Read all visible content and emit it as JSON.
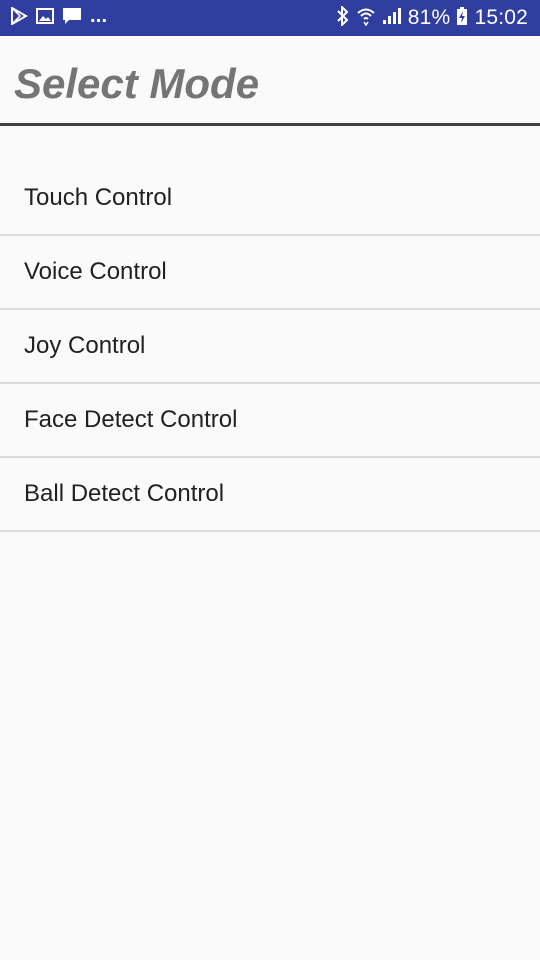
{
  "status_bar": {
    "icons_left": [
      "play-store-icon",
      "image-icon",
      "message-icon"
    ],
    "overflow": "...",
    "icons_right": [
      "bluetooth-icon",
      "wifi-icon",
      "signal-icon"
    ],
    "battery_percent": "81%",
    "time": "15:02",
    "background_color": "#303f9f"
  },
  "header": {
    "title": "Select Mode"
  },
  "modes": [
    {
      "label": "Touch Control"
    },
    {
      "label": "Voice Control"
    },
    {
      "label": "Joy Control"
    },
    {
      "label": "Face Detect Control"
    },
    {
      "label": "Ball Detect Control"
    }
  ]
}
